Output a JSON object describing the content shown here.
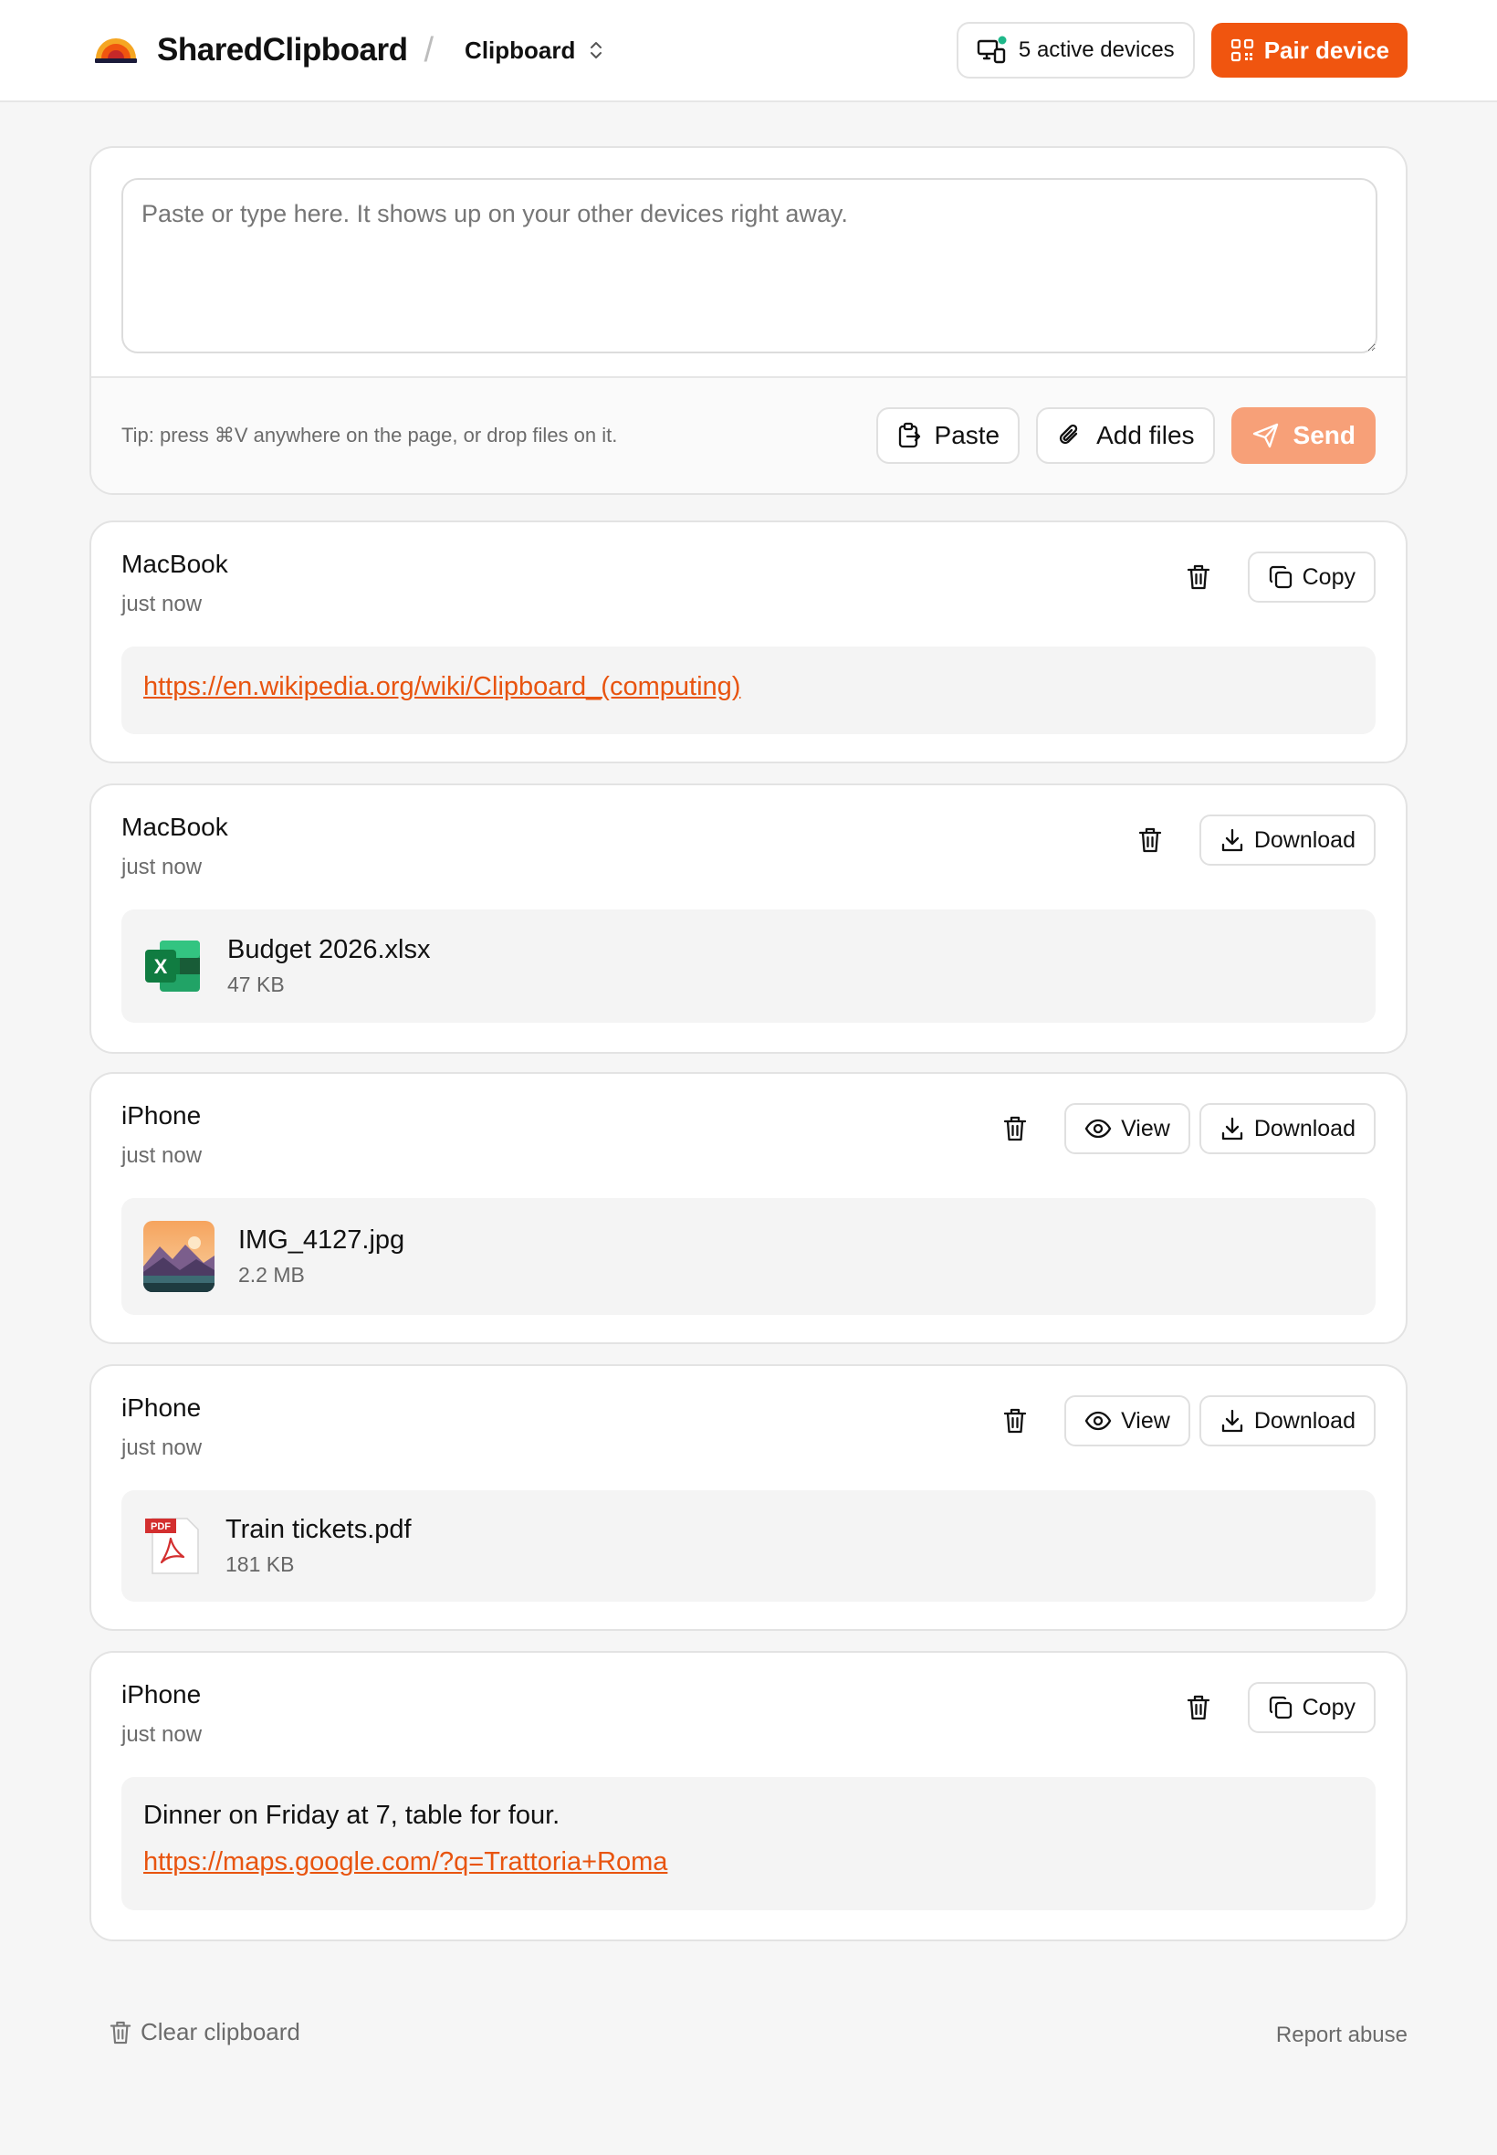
{
  "header": {
    "brand": "SharedClipboard",
    "separator": "/",
    "section": "Clipboard",
    "devices_label": "5 active devices",
    "pair_label": "Pair device",
    "accent": "#f0550f"
  },
  "composer": {
    "placeholder": "Paste or type here. It shows up on your other devices right away.",
    "tip": "Tip: press ⌘V anywhere on the page, or drop files on it.",
    "paste_label": "Paste",
    "add_files_label": "Add files",
    "send_label": "Send"
  },
  "clips": [
    {
      "device": "MacBook",
      "time": "just now",
      "type": "link",
      "url": "https://en.wikipedia.org/wiki/Clipboard_(computing)",
      "action": "Copy"
    },
    {
      "device": "MacBook",
      "time": "just now",
      "type": "file",
      "icon": "excel-file-icon",
      "name": "Budget 2026.xlsx",
      "size": "47 KB",
      "action": "Download"
    },
    {
      "device": "iPhone",
      "time": "just now",
      "type": "image",
      "icon": "image-thumbnail",
      "name": "IMG_4127.jpg",
      "size": "2.2 MB",
      "view": "View",
      "action": "Download"
    },
    {
      "device": "iPhone",
      "time": "just now",
      "type": "file",
      "icon": "pdf-file-icon",
      "name": "Train tickets.pdf",
      "size": "181 KB",
      "view": "View",
      "action": "Download"
    },
    {
      "device": "iPhone",
      "time": "just now",
      "type": "text",
      "text": "Dinner on Friday at 7, table for four.",
      "url": "https://maps.google.com/?q=Trattoria+Roma",
      "action": "Copy"
    }
  ],
  "footer": {
    "clear_label": "Clear clipboard",
    "report_label": "Report abuse"
  }
}
